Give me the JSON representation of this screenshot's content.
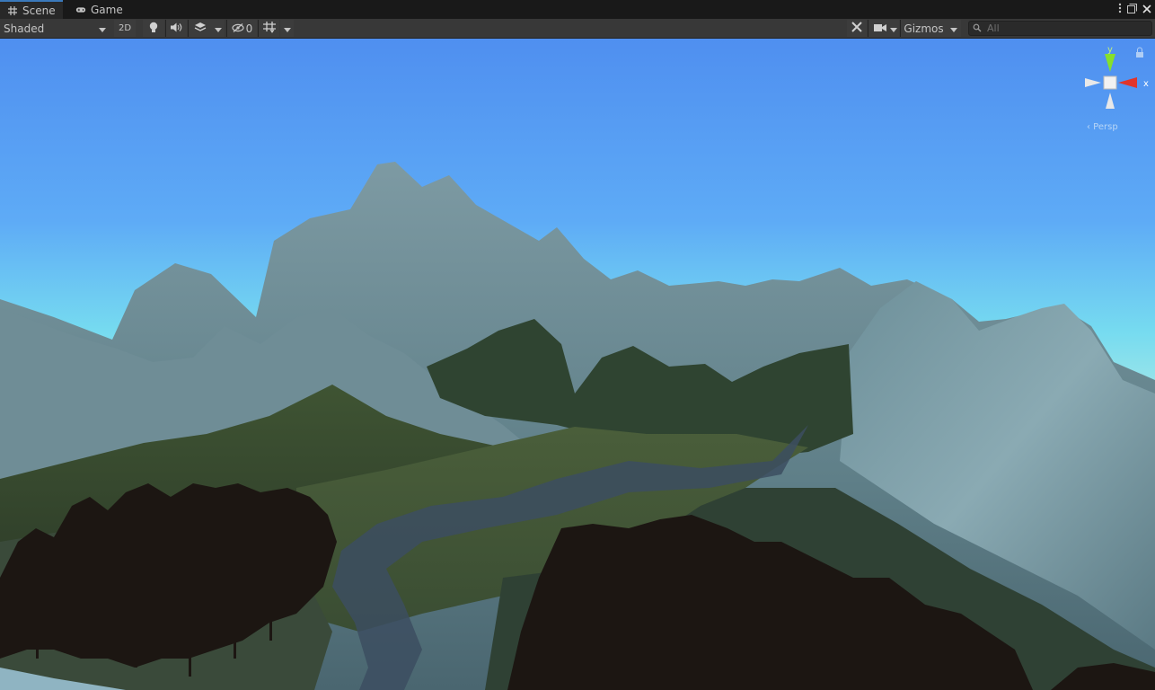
{
  "tabs": [
    {
      "label": "Scene",
      "icon": "grid-icon",
      "active": true
    },
    {
      "label": "Game",
      "icon": "gamepad-icon",
      "active": false
    }
  ],
  "toolbar": {
    "shading_mode": "Shaded",
    "mode_2d": "2D",
    "hidden_count": "0",
    "gizmos_label": "Gizmos",
    "search_placeholder": "All"
  },
  "gizmo": {
    "axis_y": "y",
    "axis_x": "x",
    "projection": "‹ Persp"
  },
  "colors": {
    "accent": "#3a79bb",
    "sky_top": "#4f8ff0",
    "sky_horizon": "#7fe0f2",
    "axis_x": "#e0352b",
    "axis_y": "#86e02b"
  }
}
